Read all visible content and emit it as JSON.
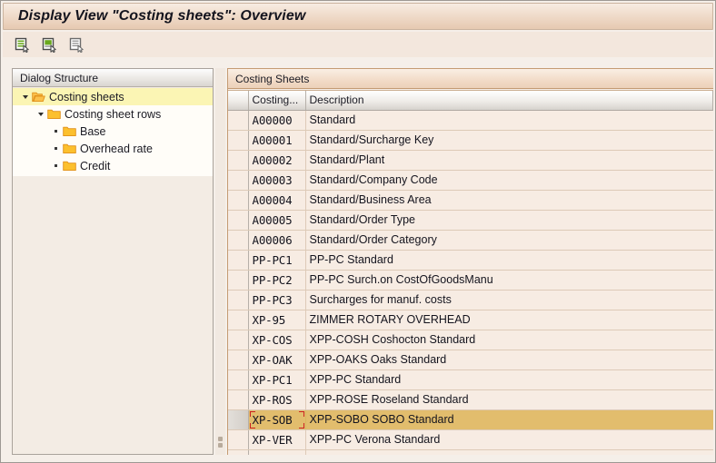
{
  "window": {
    "title": "Display View \"Costing sheets\": Overview"
  },
  "toolbar": {
    "buttons": [
      {
        "name": "details-green-full-icon",
        "tooltip": "Details"
      },
      {
        "name": "details-green-block-icon",
        "tooltip": "New Entries"
      },
      {
        "name": "details-plain-icon",
        "tooltip": "Display Details"
      }
    ]
  },
  "tree": {
    "header": "Dialog Structure",
    "nodes": [
      {
        "label": "Costing sheets",
        "depth": 0,
        "marker": "triangle",
        "folder": "open",
        "selected": true
      },
      {
        "label": "Costing sheet rows",
        "depth": 1,
        "marker": "triangle",
        "folder": "closed",
        "selected": false
      },
      {
        "label": "Base",
        "depth": 2,
        "marker": "dot",
        "folder": "closed",
        "selected": false
      },
      {
        "label": "Overhead rate",
        "depth": 2,
        "marker": "dot",
        "folder": "closed",
        "selected": false
      },
      {
        "label": "Credit",
        "depth": 2,
        "marker": "dot",
        "folder": "closed",
        "selected": false
      }
    ]
  },
  "table": {
    "panel_title": "Costing Sheets",
    "columns": [
      "",
      "Costing...",
      "Description"
    ],
    "selected_key": "XP-SOB",
    "rows": [
      {
        "key": "A00000",
        "description": "Standard"
      },
      {
        "key": "A00001",
        "description": "Standard/Surcharge Key"
      },
      {
        "key": "A00002",
        "description": "Standard/Plant"
      },
      {
        "key": "A00003",
        "description": "Standard/Company Code"
      },
      {
        "key": "A00004",
        "description": "Standard/Business Area"
      },
      {
        "key": "A00005",
        "description": "Standard/Order Type"
      },
      {
        "key": "A00006",
        "description": "Standard/Order Category"
      },
      {
        "key": "PP-PC1",
        "description": "PP-PC Standard"
      },
      {
        "key": "PP-PC2",
        "description": "PP-PC Surch.on CostOfGoodsManu"
      },
      {
        "key": "PP-PC3",
        "description": "Surcharges for manuf. costs"
      },
      {
        "key": "XP-95",
        "description": "ZIMMER ROTARY OVERHEAD"
      },
      {
        "key": "XP-COS",
        "description": "XPP-COSH Coshocton Standard"
      },
      {
        "key": "XP-OAK",
        "description": "XPP-OAKS Oaks Standard"
      },
      {
        "key": "XP-PC1",
        "description": "XPP-PC Standard"
      },
      {
        "key": "XP-ROS",
        "description": "XPP-ROSE Roseland Standard"
      },
      {
        "key": "XP-SOB",
        "description": "XPP-SOBO SOBO Standard"
      },
      {
        "key": "XP-VER",
        "description": "XPP-PC Verona Standard"
      },
      {
        "key": "",
        "description": ""
      }
    ]
  },
  "colors": {
    "title_gradient_top": "#f7ece2",
    "title_gradient_bottom": "#e6c9b1",
    "tree_selection": "#fbf5b4",
    "row_selection": "#e2bd6d",
    "focus_outline": "#cc2222",
    "folder": "#f5a623",
    "icon_green": "#6aa81e",
    "grid_background": "#f7ece3"
  }
}
